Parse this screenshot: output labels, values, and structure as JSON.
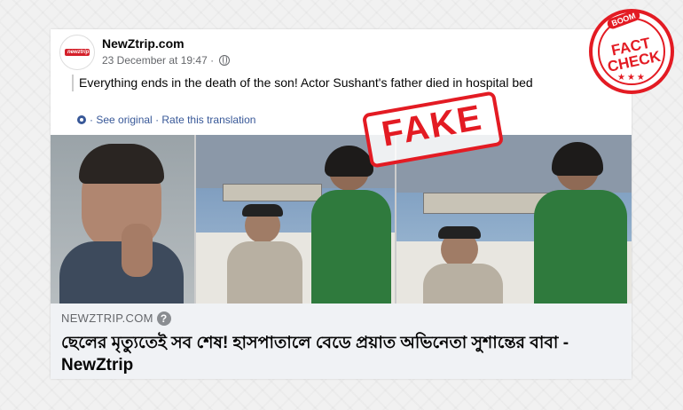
{
  "post": {
    "page_name": "NewZtrip.com",
    "avatar_text": "newztrip",
    "timestamp": "23 December at 19:47 ·",
    "more_label": "•••",
    "text": "Everything ends in the death of the son! Actor Sushant's father died in hospital bed",
    "see_original": "· See original",
    "rate_translation": "· Rate this translation"
  },
  "image": {
    "stamp_text": "FAKE"
  },
  "link_preview": {
    "domain": "NEWZTRIP.COM",
    "help_icon": "?",
    "title": "ছেলের মৃত্যুতেই সব শেষ! হাসপাতালে বেডে প্রয়াত অভিনেতা সুশান্তের বাবা - NewZtrip"
  },
  "badge": {
    "boom": "BOOM",
    "line1": "FACT",
    "line2": "CHECK",
    "stars": "★★★"
  },
  "colors": {
    "brand_red": "#e31b23",
    "link_blue": "#385898"
  }
}
